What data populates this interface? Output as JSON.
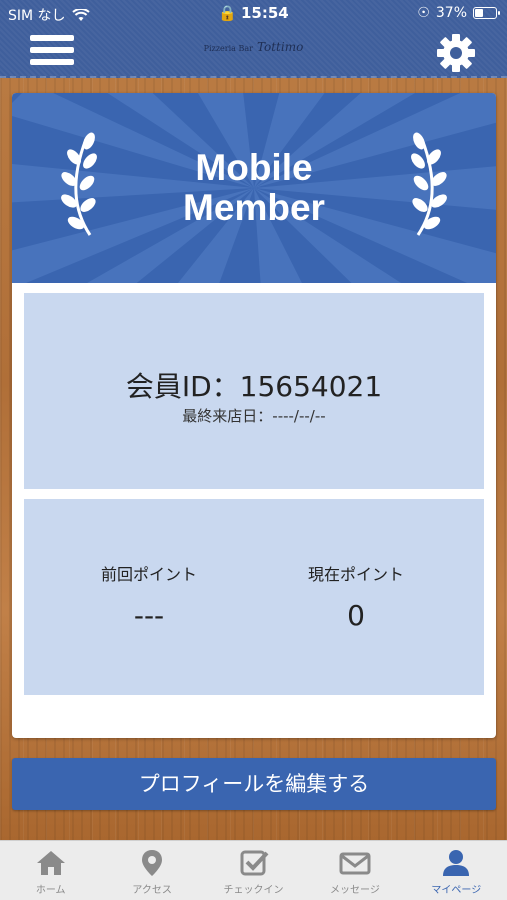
{
  "status_bar": {
    "carrier": "SIM なし",
    "time": "15:54",
    "battery": "37%"
  },
  "header": {
    "logo_small": "Pizzeria Bar",
    "logo_name": "Tottimo"
  },
  "card": {
    "banner_title_line1": "Mobile",
    "banner_title_line2": "Member",
    "member_id": "会員ID：15654021",
    "last_visit": "最終来店日：----/--/--",
    "previous_points_label": "前回ポイント",
    "previous_points_value": "---",
    "current_points_label": "現在ポイント",
    "current_points_value": "0"
  },
  "edit_profile_label": "プロフィールを編集する",
  "tabs": [
    {
      "label": "ホーム",
      "icon": "home-icon"
    },
    {
      "label": "アクセス",
      "icon": "map-pin-icon"
    },
    {
      "label": "チェックイン",
      "icon": "checkbox-icon"
    },
    {
      "label": "メッセージ",
      "icon": "envelope-icon"
    },
    {
      "label": "マイページ",
      "icon": "user-icon"
    }
  ],
  "colors": {
    "header": "#3f5f9c",
    "accent": "#3a65b0",
    "panel": "#c9d8ef",
    "tab_active": "#3a65b0"
  }
}
